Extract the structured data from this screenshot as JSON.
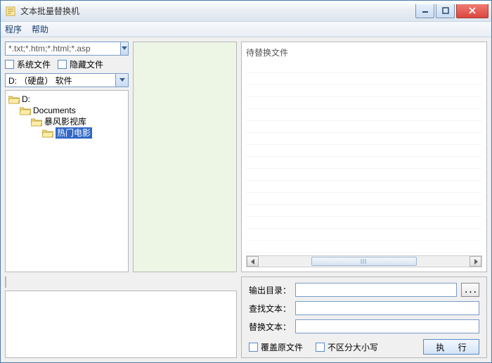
{
  "window": {
    "title": "文本批量替换机"
  },
  "menu": {
    "program": "程序",
    "help": "帮助"
  },
  "filters": {
    "pattern": "*.txt;*.htm;*.html;*.asp",
    "sysfiles": "系统文件",
    "hiddenfiles": "隐藏文件",
    "drive": "D: （硬盘） 软件"
  },
  "tree": {
    "root": "D:",
    "n1": "Documents",
    "n2": "暴风影视库",
    "n3": "热门电影"
  },
  "right": {
    "header": "待替换文件"
  },
  "form": {
    "outdir_label": "输出目录：",
    "find_label": "查找文本：",
    "replace_label": "替换文本：",
    "overwrite": "覆盖原文件",
    "ignorecase": "不区分大小写",
    "execute": "执 行",
    "browse": "..."
  }
}
